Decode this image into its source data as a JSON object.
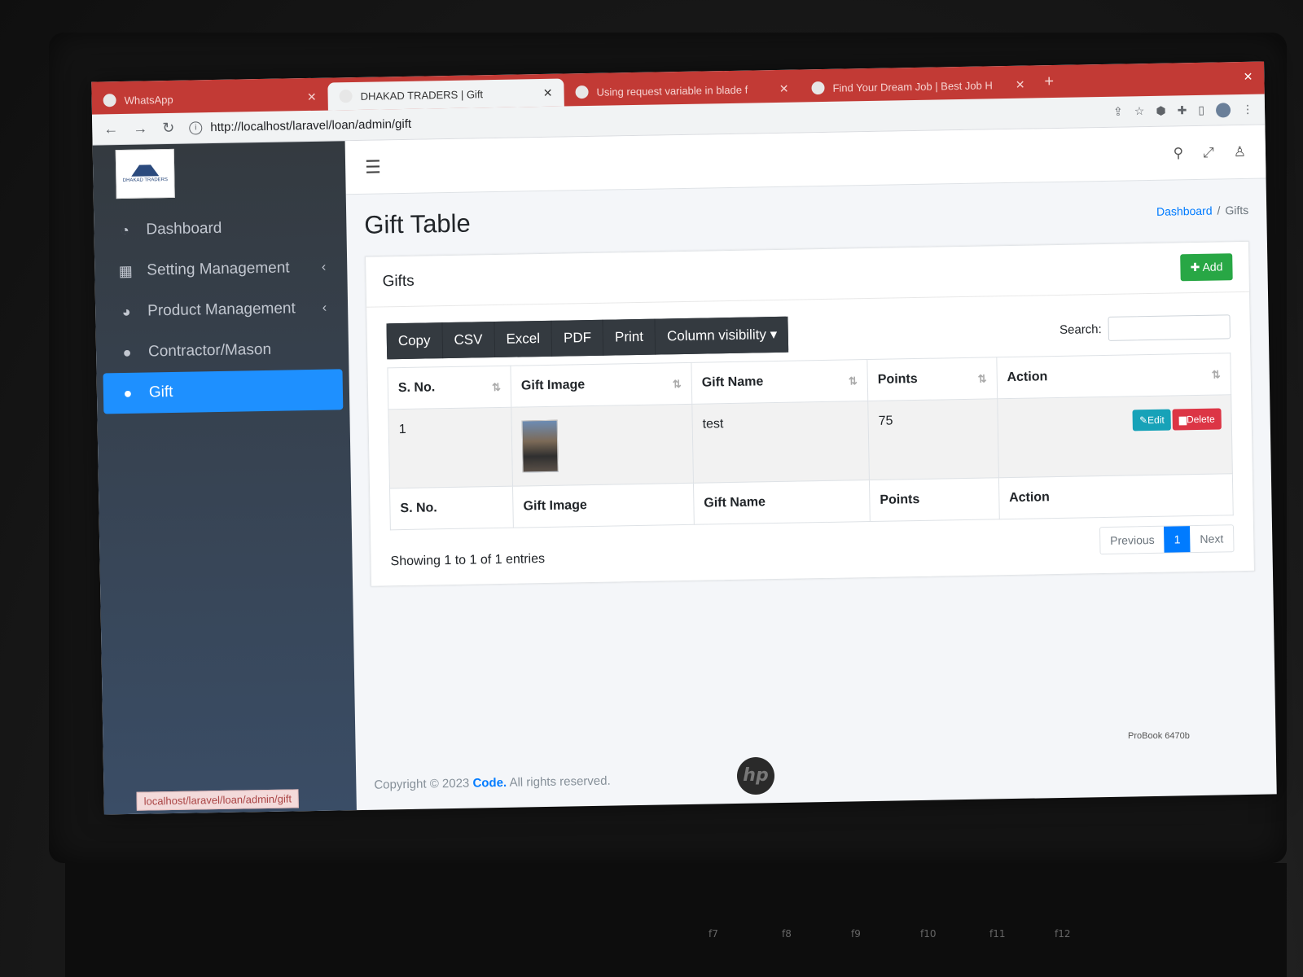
{
  "browser": {
    "tabs": [
      {
        "title": "WhatsApp",
        "active": false
      },
      {
        "title": "DHAKAD TRADERS | Gift",
        "active": true
      },
      {
        "title": "Using request variable in blade f",
        "active": false
      },
      {
        "title": "Find Your Dream Job | Best Job H",
        "active": false
      }
    ],
    "url": "http://localhost/laravel/loan/admin/gift",
    "status_url": "localhost/laravel/loan/admin/gift",
    "tab_close": "✕",
    "new_tab": "+"
  },
  "sidebar": {
    "brand_text": "DHAKAD TRADERS",
    "items": [
      {
        "label": "Dashboard",
        "icon": "tachometer-icon",
        "has_children": false,
        "active": false
      },
      {
        "label": "Setting Management",
        "icon": "grid-icon",
        "has_children": true,
        "active": false
      },
      {
        "label": "Product Management",
        "icon": "pie-chart-icon",
        "has_children": true,
        "active": false
      },
      {
        "label": "Contractor/Mason",
        "icon": "user-icon",
        "has_children": false,
        "active": false
      },
      {
        "label": "Gift",
        "icon": "user-icon",
        "has_children": false,
        "active": true
      }
    ]
  },
  "topnav": {
    "icons": [
      "search-icon",
      "expand-icon",
      "user-icon"
    ]
  },
  "header": {
    "title": "Gift Table",
    "breadcrumb": [
      "Dashboard",
      "Gifts"
    ],
    "breadcrumb_sep": "/"
  },
  "card": {
    "title": "Gifts",
    "add_label": "Add"
  },
  "datatable": {
    "buttons": [
      "Copy",
      "CSV",
      "Excel",
      "PDF",
      "Print",
      "Column visibility"
    ],
    "search_label": "Search:",
    "columns": [
      "S. No.",
      "Gift Image",
      "Gift Name",
      "Points",
      "Action"
    ],
    "rows": [
      {
        "sno": "1",
        "gift_name": "test",
        "points": "75",
        "edit_label": "Edit",
        "delete_label": "Delete"
      }
    ],
    "info": "Showing 1 to 1 of 1 entries",
    "pagination": {
      "previous": "Previous",
      "current": "1",
      "next": "Next"
    }
  },
  "footer": {
    "prefix": "Copyright © 2023",
    "brand": "Code.",
    "suffix": "All rights reserved."
  },
  "device": {
    "logo": "hp",
    "model": "ProBook 6470b"
  },
  "colors": {
    "accent": "#1e90ff",
    "sidebar": "#343a40",
    "add_button": "#28a745",
    "edit_button": "#17a2b8",
    "delete_button": "#dc3545",
    "tabbar": "#c23a35"
  }
}
